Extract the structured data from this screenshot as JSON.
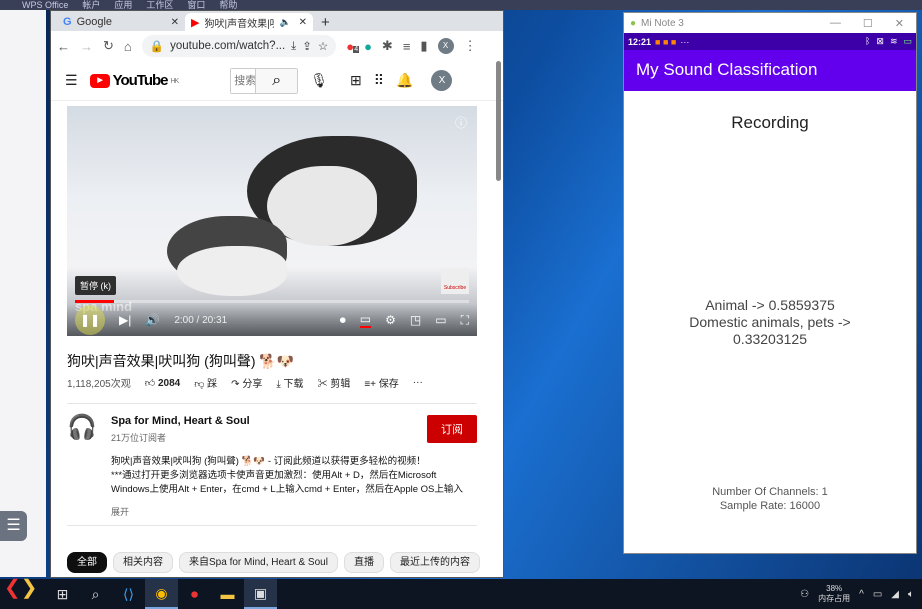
{
  "os_menu": [
    "WPS Office",
    "帐户",
    "应用",
    "工作区",
    "窗口",
    "帮助"
  ],
  "browser": {
    "tabs": [
      {
        "label": "Google",
        "icon": "google-icon"
      },
      {
        "label": "狗吠|声音效果|吠叫",
        "icon": "youtube-icon",
        "audio": true
      }
    ],
    "url": "youtube.com/watch?...",
    "extension_badge": "4",
    "profile": "X"
  },
  "youtube": {
    "logo": "YouTube",
    "region": "HK",
    "search_placeholder": "搜索",
    "avatar": "X",
    "video": {
      "tooltip": "暂停 (k)",
      "watermark": "spa mind",
      "current_time": "2:00",
      "duration": "20:31",
      "time_display": "2:00 / 20:31",
      "progress": 0.098,
      "subscribe_overlay": "Subscribe"
    },
    "title": "狗吠|声音效果|吠叫狗 (狗叫聲) 🐕🐶",
    "views": "1,118,205次观",
    "likes": "2084",
    "dislike": "踩",
    "share": "分享",
    "download": "下载",
    "clip": "剪辑",
    "save": "保存",
    "channel": {
      "name": "Spa for Mind, Heart & Soul",
      "subscribers": "21万位订阅者",
      "subscribe": "订阅"
    },
    "description": [
      "狗吠|声音效果|吠叫狗 (狗叫聲) 🐕🐶 - 订阅此频道以获得更多轻松的视频！",
      "***通过打开更多浏览器选项卡使声音更加激烈：使用Alt + D，然后在Microsoft",
      "Windows上使用Alt + Enter，在cmd + L上输入cmd + Enter，然后在Apple OS上输入"
    ],
    "more": "展开",
    "chips": [
      "全部",
      "相关内容",
      "来自Spa for Mind, Heart & Soul",
      "直播",
      "最近上传的内容"
    ]
  },
  "phone": {
    "window_title": "Mi Note 3",
    "time": "12:21",
    "app_title": "My Sound Classification",
    "state": "Recording",
    "results": [
      "Animal -> 0.5859375",
      "Domestic animals, pets ->",
      "0.33203125"
    ],
    "channels": "Number Of Channels: 1",
    "sample_rate": "Sample Rate: 16000",
    "colors": {
      "appbar": "#6200ee",
      "statusbar": "#3d00a8"
    }
  },
  "taskbar": {
    "memory_percent": "38%",
    "memory_label": "内存占用"
  }
}
